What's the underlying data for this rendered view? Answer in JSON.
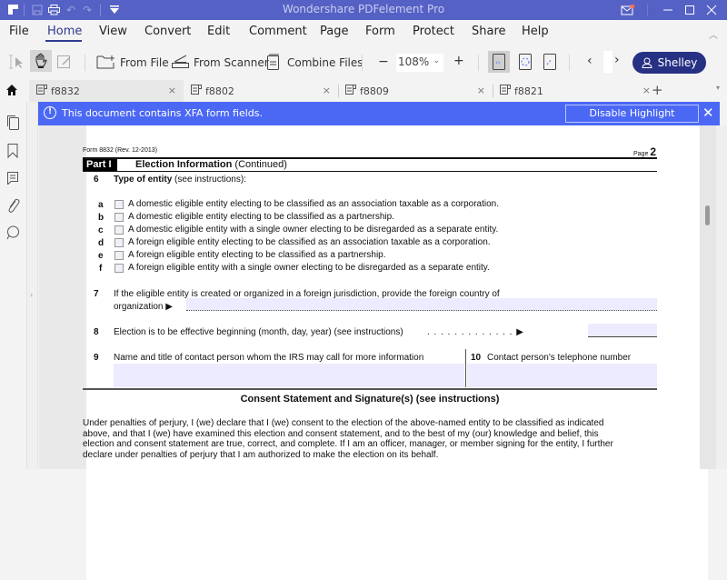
{
  "app": {
    "title": "Wondershare PDFelement Pro",
    "colors": {
      "titlebar": "#5561c4",
      "accent": "#273184",
      "banner": "#4b68f5",
      "field_highlight": "#ecebff"
    }
  },
  "quick_access": {
    "icons": [
      "app-logo-icon",
      "save-icon",
      "print-icon",
      "undo-icon",
      "redo-icon",
      "customize-dropdown-icon"
    ]
  },
  "window_controls": [
    "mail-icon",
    "minimize-icon",
    "maximize-icon",
    "close-icon"
  ],
  "menu": {
    "items": [
      "File",
      "Home",
      "View",
      "Convert",
      "Edit",
      "Comment",
      "Page",
      "Form",
      "Protect",
      "Share",
      "Help"
    ],
    "active": "Home"
  },
  "toolbar": {
    "from_file": "From File",
    "from_scanner": "From Scanner",
    "combine_files": "Combine Files",
    "zoom_out": "−",
    "zoom_level": "108%",
    "zoom_in": "+",
    "prev": "‹",
    "next": "›",
    "user": "Shelley"
  },
  "tabs": [
    {
      "label": "f8832",
      "active": true
    },
    {
      "label": "f8802",
      "active": false
    },
    {
      "label": "f8809",
      "active": false
    },
    {
      "label": "f8821",
      "active": false
    }
  ],
  "banner": {
    "message": "This document contains XFA form fields.",
    "button": "Disable Highlight"
  },
  "document": {
    "form_id": "Form 8832 (Rev. 12-2013)",
    "page_label": "Page",
    "page_number": "2",
    "part_label": "Part I",
    "part_title": "Election Information",
    "part_title_suffix": "(Continued)",
    "line6": {
      "num": "6",
      "title": "Type of entity",
      "suffix": "(see instructions):"
    },
    "options": [
      {
        "letter": "a",
        "text": "A domestic eligible entity electing to be classified as an association taxable as a corporation.",
        "checked": false
      },
      {
        "letter": "b",
        "text": "A domestic eligible entity electing to be classified as a partnership.",
        "checked": false
      },
      {
        "letter": "c",
        "text": "A domestic eligible entity with a single owner electing to be disregarded as a separate entity.",
        "checked": false
      },
      {
        "letter": "d",
        "text": "A foreign eligible entity electing to be classified as an association taxable as a corporation.",
        "checked": false
      },
      {
        "letter": "e",
        "text": "A foreign eligible entity electing to be classified as a partnership.",
        "checked": false
      },
      {
        "letter": "f",
        "text": "A foreign eligible entity with a single owner electing to be disregarded as a separate entity.",
        "checked": false
      }
    ],
    "line7": {
      "num": "7",
      "text1": "If the eligible entity is created or organized in a foreign jurisdiction, provide the foreign country of",
      "text2": "organization ▶",
      "value": ""
    },
    "line8": {
      "num": "8",
      "text": "Election is to be effective beginning (month, day, year) (see instructions)",
      "dots": ". . . . . . . . . . . . . ▶",
      "value": ""
    },
    "line9": {
      "num": "9",
      "text": "Name and title of contact person whom the IRS may call for more information",
      "value": ""
    },
    "line10": {
      "num": "10",
      "text": "Contact person's telephone number",
      "value": ""
    },
    "consent_heading": "Consent Statement and Signature(s) (see instructions)",
    "consent_lines": [
      "Under penalties of perjury, I (we) declare that I (we) consent to the election of the above-named entity to be classified as indicated",
      "above, and that I (we) have examined this election and consent statement, and to the best of my (our) knowledge and belief, this",
      "election and consent statement are true, correct, and complete. If I am an officer, manager, or member signing for the entity, I further",
      "declare under penalties of perjury that I am authorized to make the election on its behalf."
    ]
  },
  "left_sidebar": [
    "home-icon",
    "thumbnails-icon",
    "bookmark-icon",
    "comment-icon",
    "attachment-icon",
    "search-icon"
  ]
}
